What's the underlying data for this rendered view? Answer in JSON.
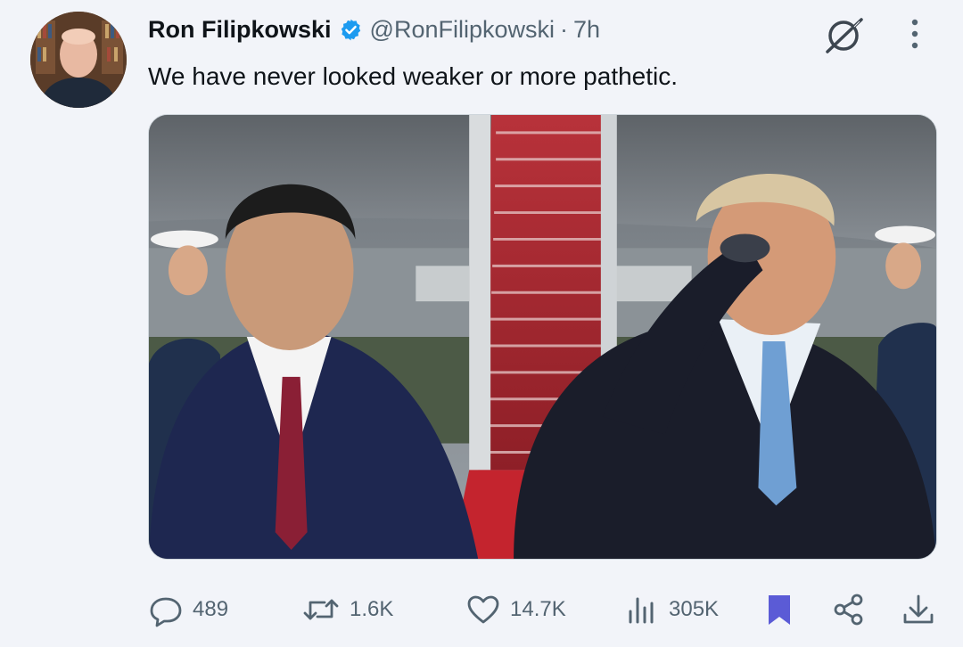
{
  "author": {
    "name": "Ron Filipkowski",
    "handle": "@RonFilipkowski",
    "separator": "·",
    "time": "7h",
    "verified_color": "#1d9bf0"
  },
  "post": {
    "text": "We have never looked weaker or more pathetic."
  },
  "media": {
    "type": "video-frame",
    "subject": "two men in dark suits at an aircraft stairway with red carpet"
  },
  "actions": {
    "replies": "489",
    "reposts": "1.6K",
    "likes": "14.7K",
    "views": "305K",
    "bookmarked": true,
    "bookmark_color": "#5b5bd6"
  },
  "icons": {
    "verified": "verified-badge-icon",
    "grok": "grok-icon",
    "more": "more-vertical-icon",
    "reply": "reply-icon",
    "repost": "repost-icon",
    "like": "heart-icon",
    "views": "views-icon",
    "bookmark": "bookmark-icon",
    "share": "share-icon",
    "download": "download-icon"
  }
}
